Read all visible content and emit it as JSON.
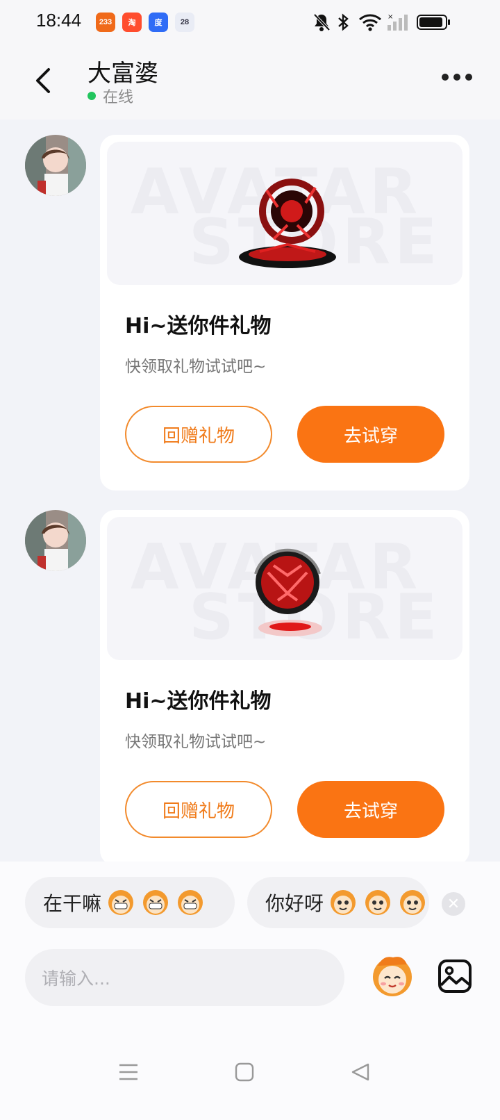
{
  "status_bar": {
    "time": "18:44",
    "app_badges": [
      {
        "text": "233",
        "color": "#f06a1a"
      },
      {
        "text": "淘",
        "color": "#ff4d2e"
      },
      {
        "text": "度",
        "color": "#2f6cf6"
      },
      {
        "text": "28",
        "color": "#e9ecf5"
      }
    ],
    "icons": [
      "mute-bell-icon",
      "bluetooth-icon",
      "wifi-icon",
      "cellular-icon",
      "battery-icon"
    ]
  },
  "header": {
    "title": "大富婆",
    "status": "在线"
  },
  "messages": [
    {
      "watermark_line1": "AVATAR",
      "watermark_line2": "STORE",
      "title": "Hi~送你件礼物",
      "subtitle": "快领取礼物试试吧~",
      "return_gift_label": "回赠礼物",
      "try_on_label": "去试穿"
    },
    {
      "watermark_line1": "AVATAR",
      "watermark_line2": "STORE",
      "title": "Hi~送你件礼物",
      "subtitle": "快领取礼物试试吧~",
      "return_gift_label": "回赠礼物",
      "try_on_label": "去试穿"
    }
  ],
  "quick_replies": [
    {
      "text": "在干嘛"
    },
    {
      "text": "你好呀"
    }
  ],
  "composer": {
    "placeholder": "请输入..."
  },
  "colors": {
    "accent": "#fa7413",
    "online": "#22c55e"
  }
}
